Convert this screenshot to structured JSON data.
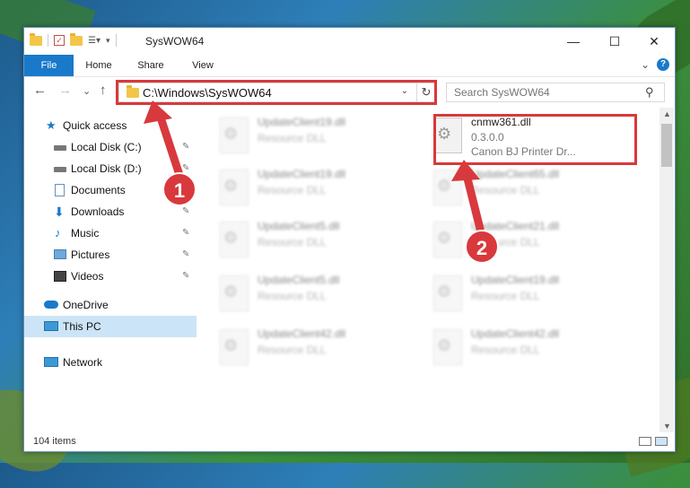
{
  "window": {
    "title": "SysWOW64",
    "min_symbol": "—",
    "max_symbol": "☐",
    "close_symbol": "✕"
  },
  "ribbon": {
    "tabs": [
      "File",
      "Home",
      "Share",
      "View"
    ],
    "expand_symbol": "⌄",
    "help_symbol": "?"
  },
  "nav": {
    "back": "←",
    "forward": "→",
    "recent": "⌄",
    "up": "↑",
    "address": "C:\\Windows\\SysWOW64",
    "address_dropdown": "⌄",
    "refresh": "↻",
    "search_placeholder": "Search SysWOW64",
    "search_icon": "⚲"
  },
  "sidebar": {
    "items": [
      {
        "label": "Quick access",
        "icon": "star-icon",
        "pinned": false
      },
      {
        "label": "Local Disk (C:)",
        "icon": "drive-icon",
        "pinned": true
      },
      {
        "label": "Local Disk (D:)",
        "icon": "drive-icon",
        "pinned": true
      },
      {
        "label": "Documents",
        "icon": "documents-icon",
        "pinned": true
      },
      {
        "label": "Downloads",
        "icon": "downloads-icon",
        "pinned": true
      },
      {
        "label": "Music",
        "icon": "music-icon",
        "pinned": true
      },
      {
        "label": "Pictures",
        "icon": "pictures-icon",
        "pinned": true
      },
      {
        "label": "Videos",
        "icon": "videos-icon",
        "pinned": true
      },
      {
        "label": "OneDrive",
        "icon": "cloud-icon",
        "pinned": false
      },
      {
        "label": "This PC",
        "icon": "computer-icon",
        "pinned": false,
        "selected": true
      },
      {
        "label": "Network",
        "icon": "network-icon",
        "pinned": false
      }
    ]
  },
  "files": {
    "highlighted": {
      "name": "cnmw361.dll",
      "version": "0.3.0.0",
      "description": "Canon BJ Printer Dr..."
    },
    "others": [
      {
        "name": "UpdateClient19.dll",
        "description": "Resource DLL"
      },
      {
        "name": "UpdateClient19.dll",
        "description": "Resource DLL"
      },
      {
        "name": "UpdateClient65.dll",
        "description": "Resource DLL"
      },
      {
        "name": "UpdateClient5.dll",
        "description": "Resource DLL"
      },
      {
        "name": "UpdateClient21.dll",
        "description": "Resource DLL"
      },
      {
        "name": "UpdateClient5.dll",
        "description": "Resource DLL"
      },
      {
        "name": "UpdateClient19.dll",
        "description": "Resource DLL"
      },
      {
        "name": "UpdateClient42.dll",
        "description": "Resource DLL"
      },
      {
        "name": "UpdateClient42.dll",
        "description": "Resource DLL"
      }
    ]
  },
  "status": {
    "count": "104 items"
  },
  "annotations": {
    "step1": "1",
    "step2": "2"
  },
  "colors": {
    "accent": "#1979ca",
    "highlight": "#d8393c",
    "selection": "#cce4f7"
  }
}
